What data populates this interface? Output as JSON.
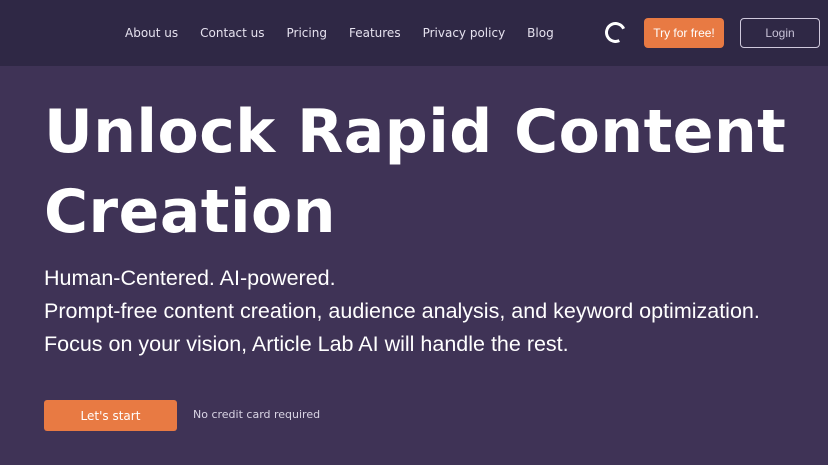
{
  "nav": {
    "links": [
      "About us",
      "Contact us",
      "Pricing",
      "Features",
      "Privacy policy",
      "Blog"
    ],
    "try_label": "Try for free!",
    "login_label": "Login"
  },
  "hero": {
    "title": "Unlock Rapid Content Creation",
    "lines": [
      "Human-Centered. AI-powered.",
      "Prompt-free content creation, audience analysis, and keyword optimization.",
      "Focus on your vision, Article Lab AI will handle the rest."
    ],
    "cta_label": "Let's start",
    "note": "No credit card required"
  },
  "colors": {
    "background": "#3f3356",
    "navbar": "#2f2845",
    "accent": "#e87a43"
  },
  "icons": {
    "loader": "loading-spinner-icon"
  }
}
